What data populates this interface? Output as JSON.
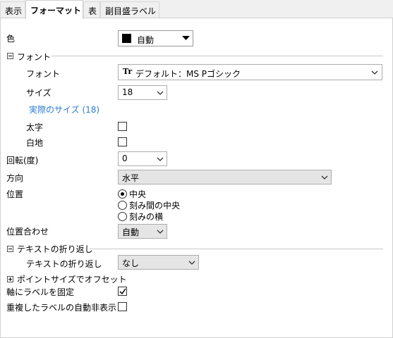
{
  "tabs": [
    {
      "label": "表示",
      "active": false
    },
    {
      "label": "フォーマット",
      "active": true
    },
    {
      "label": "表",
      "active": false
    },
    {
      "label": "副目盛ラベル",
      "active": false
    }
  ],
  "color": {
    "label": "色",
    "value": "自動",
    "swatch": "#000000"
  },
  "font_section": {
    "title": "フォント",
    "font_label": "フォント",
    "font_value": "デフォルト：MS Pゴシック",
    "font_icon_text": "Tr",
    "size_label": "サイズ",
    "size_value": "18",
    "actual_size_link": "実際のサイズ (18)",
    "bold_label": "太字",
    "bold_checked": false,
    "whiteout_label": "白地",
    "whiteout_checked": false
  },
  "rotation": {
    "label": "回転(度)",
    "value": "0"
  },
  "direction": {
    "label": "方向",
    "value": "水平"
  },
  "position": {
    "label": "位置",
    "options": [
      "中央",
      "刻み間の中央",
      "刻みの横"
    ],
    "selected": 0
  },
  "alignment": {
    "label": "位置合わせ",
    "value": "自動"
  },
  "wrap_section": {
    "title": "テキストの折り返し",
    "label": "テキストの折り返し",
    "value": "なし"
  },
  "offset_section": {
    "title": "ポイントサイズでオフセット"
  },
  "fix_labels": {
    "label": "軸にラベルを固定",
    "checked": true
  },
  "auto_hide": {
    "label": "重複したラベルの自動非表示",
    "checked": false
  },
  "colors": {
    "link": "#2a7ad5",
    "panel_bg": "#ffffff",
    "window_bg": "#f0f0f0"
  }
}
